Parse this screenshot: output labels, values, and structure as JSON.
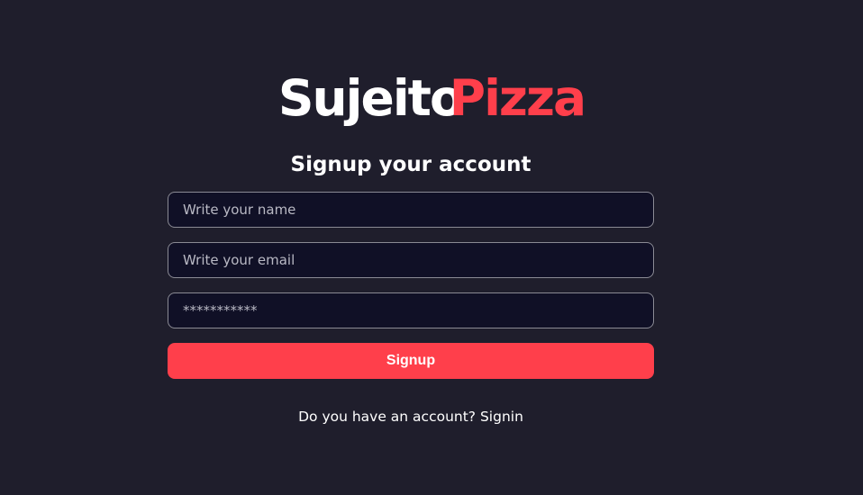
{
  "logo": {
    "part1": "Sujeito",
    "part2": "Pizza",
    "accent_color": "#ff3f4b"
  },
  "form": {
    "title": "Signup your account",
    "name_placeholder": "Write your name",
    "email_placeholder": "Write your email",
    "password_placeholder": "***********",
    "submit_label": "Signup"
  },
  "footer": {
    "link_text": "Do you have an account? Signin"
  },
  "colors": {
    "background": "#1f1e2c",
    "input_background": "#101026",
    "button": "#ff3f4b"
  }
}
